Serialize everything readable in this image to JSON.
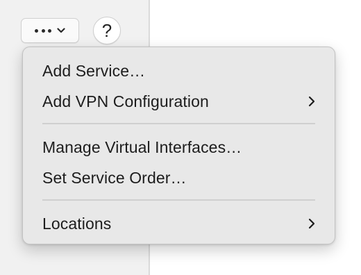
{
  "toolbar": {
    "action_button_icon": "ellipsis-icon",
    "action_button_chevron": "chevron-down-icon",
    "help_label": "?"
  },
  "menu": {
    "items": [
      {
        "label": "Add Service…",
        "has_submenu": false
      },
      {
        "label": "Add VPN Configuration",
        "has_submenu": true
      },
      {
        "label": "Manage Virtual Interfaces…",
        "has_submenu": false
      },
      {
        "label": "Set Service Order…",
        "has_submenu": false
      },
      {
        "label": "Locations",
        "has_submenu": true
      }
    ]
  }
}
